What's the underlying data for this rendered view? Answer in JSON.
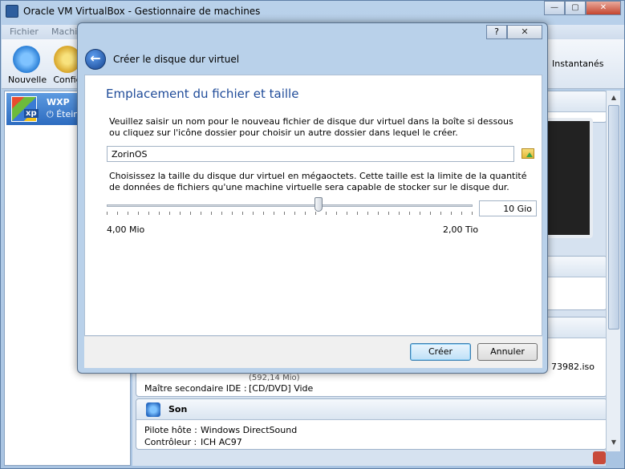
{
  "main": {
    "title": "Oracle VM VirtualBox - Gestionnaire de machines",
    "menu": [
      "Fichier",
      "Machine"
    ],
    "toolbar": {
      "new_label": "Nouvelle",
      "config_label": "Config",
      "snapshots_label": "Instantanés"
    },
    "vm": {
      "name": "WXP",
      "state": "Éteinte",
      "logo_text": "xp"
    },
    "storage": {
      "size_fragment": "(592,14 Mio)",
      "iso_fragment": "73982.iso",
      "ide_key": "Maître secondaire IDE :",
      "ide_value": "[CD/DVD] Vide"
    },
    "sound": {
      "title": "Son",
      "host_driver_key": "Pilote hôte :",
      "host_driver_value": "Windows DirectSound",
      "controller_key": "Contrôleur :",
      "controller_value": "ICH AC97"
    }
  },
  "dialog": {
    "title": "Créer le disque dur virtuel",
    "heading": "Emplacement du fichier et taille",
    "text_location": "Veuillez saisir un nom pour le nouveau fichier de disque dur virtuel dans la boîte si dessous ou cliquez sur l'icône dossier pour choisir un autre dossier dans lequel le créer.",
    "filename_value": "ZorinOS",
    "text_size": "Choisissez la taille du disque dur virtuel en mégaoctets. Cette taille est la limite de la quantité de données de fichiers qu'une machine virtuelle sera capable de stocker sur le disque dur.",
    "size_value": "10 Gio",
    "slider_fraction": 0.58,
    "min_label": "4,00 Mio",
    "max_label": "2,00 Tio",
    "create_label": "Créer",
    "cancel_label": "Annuler",
    "help_label": "?",
    "close_label": "✕"
  }
}
